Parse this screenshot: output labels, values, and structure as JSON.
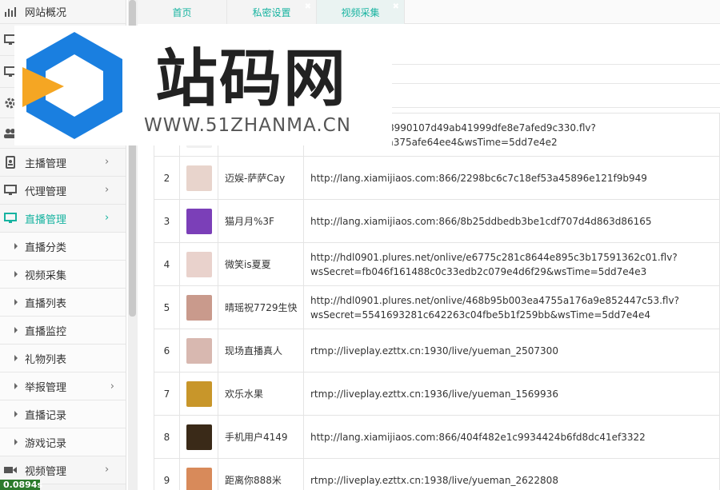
{
  "sidebar": {
    "items": [
      {
        "label": "网站概况",
        "icon": "bar-chart-icon"
      },
      {
        "label": "",
        "icon": "monitor-icon"
      },
      {
        "label": "",
        "icon": "monitor-icon"
      },
      {
        "label": "",
        "icon": "gear-icon"
      },
      {
        "label": "",
        "icon": "users-icon"
      },
      {
        "label": "主播管理",
        "icon": "id-badge-icon"
      },
      {
        "label": "代理管理",
        "icon": "monitor-icon"
      },
      {
        "label": "直播管理",
        "icon": "monitor-icon"
      }
    ],
    "sub_items": [
      "直播分类",
      "视频采集",
      "直播列表",
      "直播监控",
      "礼物列表",
      "举报管理",
      "直播记录",
      "游戏记录"
    ],
    "bottom_item": {
      "label": "视频管理",
      "icon": "video-camera-icon"
    },
    "speed_badge": "0.0894s"
  },
  "tabs": [
    {
      "label": "首页"
    },
    {
      "label": "私密设置"
    },
    {
      "label": "视频采集"
    }
  ],
  "watermark": {
    "text": "站码网",
    "url": "WWW.51ZHANMA.CN"
  },
  "table": {
    "rows": [
      {
        "num": "",
        "name": "",
        "url_1": "lures.net/onlive/8990107d49ab41999dfe8e7afed9c330.flv?",
        "url_2": "d09ca00ec1a96a375afe64ee4&wsTime=5dd7e4e2",
        "color": "#f0f0f0"
      },
      {
        "num": "2",
        "name": "迈娱-萨萨Cay",
        "url_1": "http://lang.xiamijiaos.com:866/2298bc6c7c18ef53a45896e121f9b949",
        "url_2": "",
        "color": "#e8d4cc"
      },
      {
        "num": "3",
        "name": "猫月月%3F",
        "url_1": "http://lang.xiamijiaos.com:866/8b25ddbedb3be1cdf707d4d863d86165",
        "url_2": "",
        "color": "#7b3fb8"
      },
      {
        "num": "4",
        "name": "微笑is夏夏",
        "url_1": "http://hdl0901.plures.net/onlive/e6775c281c8644e895c3b17591362c01.flv?",
        "url_2": "wsSecret=fb046f161488c0c33edb2c079e4d6f29&wsTime=5dd7e4e3",
        "color": "#e9d2cc"
      },
      {
        "num": "5",
        "name": "晴瑶祝7729生快",
        "url_1": "http://hdl0901.plures.net/onlive/468b95b003ea4755a176a9e852447c53.flv?",
        "url_2": "wsSecret=5541693281c642263c04fbe5b1f259bb&wsTime=5dd7e4e4",
        "color": "#c99a8c"
      },
      {
        "num": "6",
        "name": "现场直播真人",
        "url_1": "rtmp://liveplay.ezttx.cn:1930/live/yueman_2507300",
        "url_2": "",
        "color": "#d8b8b0"
      },
      {
        "num": "7",
        "name": "欢乐水果",
        "url_1": "rtmp://liveplay.ezttx.cn:1936/live/yueman_1569936",
        "url_2": "",
        "color": "#c8962a"
      },
      {
        "num": "8",
        "name": "手机用户4149",
        "url_1": "http://lang.xiamijiaos.com:866/404f482e1c9934424b6fd8dc41ef3322",
        "url_2": "",
        "color": "#3a2a18"
      },
      {
        "num": "9",
        "name": "距离你888米",
        "url_1": "rtmp://liveplay.ezttx.cn:1938/live/yueman_2622808",
        "url_2": "",
        "color": "#d88a5a"
      }
    ]
  },
  "colors": {
    "accent": "#16b3a0",
    "logo_blue": "#1a7fe0",
    "logo_orange": "#f5a623"
  }
}
